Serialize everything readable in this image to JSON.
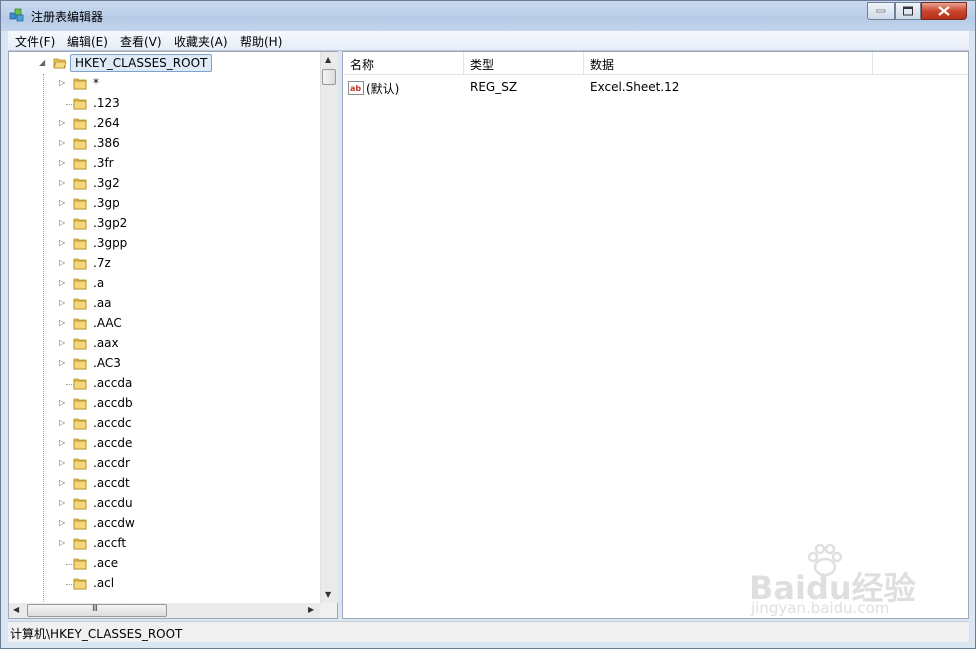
{
  "window": {
    "title": "注册表编辑器"
  },
  "menu": [
    "文件(F)",
    "编辑(E)",
    "查看(V)",
    "收藏夹(A)",
    "帮助(H)"
  ],
  "tree": {
    "root": "HKEY_CLASSES_ROOT",
    "nodes": [
      {
        "label": "*",
        "expandable": true
      },
      {
        "label": ".123",
        "expandable": false
      },
      {
        "label": ".264",
        "expandable": true
      },
      {
        "label": ".386",
        "expandable": true
      },
      {
        "label": ".3fr",
        "expandable": true
      },
      {
        "label": ".3g2",
        "expandable": true
      },
      {
        "label": ".3gp",
        "expandable": true
      },
      {
        "label": ".3gp2",
        "expandable": true
      },
      {
        "label": ".3gpp",
        "expandable": true
      },
      {
        "label": ".7z",
        "expandable": true
      },
      {
        "label": ".a",
        "expandable": true
      },
      {
        "label": ".aa",
        "expandable": true
      },
      {
        "label": ".AAC",
        "expandable": true
      },
      {
        "label": ".aax",
        "expandable": true
      },
      {
        "label": ".AC3",
        "expandable": true
      },
      {
        "label": ".accda",
        "expandable": false
      },
      {
        "label": ".accdb",
        "expandable": true
      },
      {
        "label": ".accdc",
        "expandable": true
      },
      {
        "label": ".accde",
        "expandable": true
      },
      {
        "label": ".accdr",
        "expandable": true
      },
      {
        "label": ".accdt",
        "expandable": true
      },
      {
        "label": ".accdu",
        "expandable": true
      },
      {
        "label": ".accdw",
        "expandable": true
      },
      {
        "label": ".accft",
        "expandable": true
      },
      {
        "label": ".ace",
        "expandable": false
      },
      {
        "label": ".acl",
        "expandable": false
      }
    ]
  },
  "columns": {
    "name": "名称",
    "type": "类型",
    "data": "数据"
  },
  "values": [
    {
      "name": "(默认)",
      "type": "REG_SZ",
      "data": "Excel.Sheet.12",
      "icon": "string-value-icon"
    }
  ],
  "status": {
    "path": "计算机\\HKEY_CLASSES_ROOT"
  },
  "watermark": {
    "brand": "Baidu经验",
    "url": "jingyan.baidu.com"
  },
  "scrollbar": {
    "grip": "III"
  }
}
